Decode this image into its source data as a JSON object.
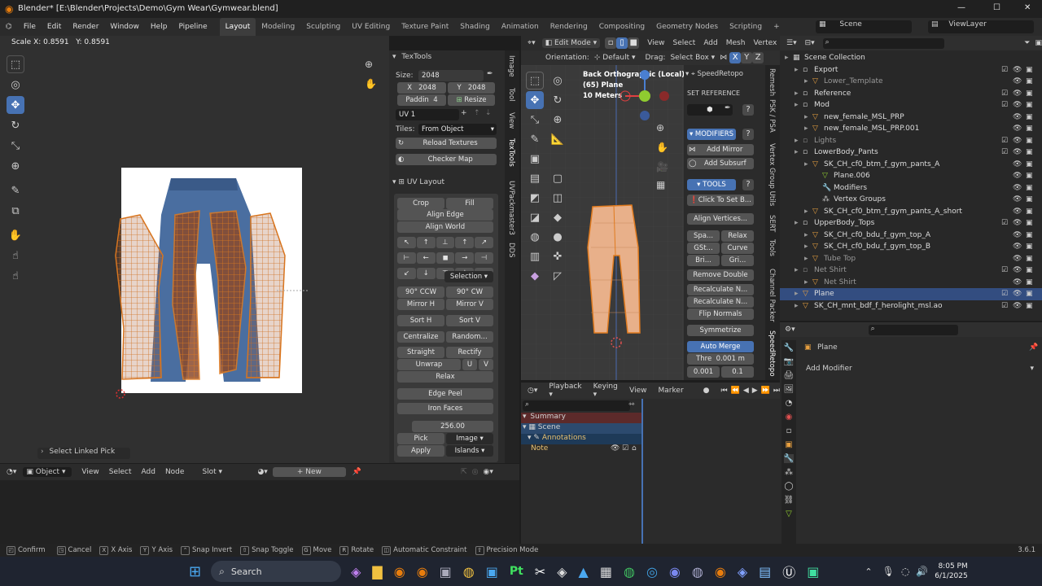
{
  "window": {
    "title": "Blender* [E:\\Blender\\Projects\\Demo\\Gym Wear\\Gymwear.blend]",
    "minimize": "—",
    "maximize": "☐",
    "close": "✕"
  },
  "menu": [
    "File",
    "Edit",
    "Render",
    "Window",
    "Help",
    "Pipeline"
  ],
  "workspaces": [
    "Layout",
    "Modeling",
    "Sculpting",
    "UV Editing",
    "Texture Paint",
    "Shading",
    "Animation",
    "Rendering",
    "Compositing",
    "Geometry Nodes",
    "Scripting"
  ],
  "active_workspace": "Layout",
  "scene_field": "Scene",
  "viewlayer_field": "ViewLayer",
  "uv_editor": {
    "header_text": "Scale X: 0.8591   Y: 0.8591",
    "select_linked_hint": "Select Linked Pick",
    "scale_value": "0.8591"
  },
  "textools": {
    "title": "TexTools",
    "size_label": "Size:",
    "size_value": "2048",
    "x_label": "X",
    "x_value": "2048",
    "y_label": "Y",
    "y_value": "2048",
    "padding_label": "Paddin",
    "padding_value": "4",
    "resize": "Resize",
    "uv_map": "UV 1",
    "tiles_label": "Tiles:",
    "tiles_value": "From Object",
    "reload": "Reload Textures",
    "checker": "Checker Map",
    "uv_layout": "UV Layout",
    "crop": "Crop",
    "fill": "Fill",
    "align_edge": "Align Edge",
    "align_world": "Align World",
    "selection": "Selection",
    "ccw": "90° CCW",
    "cw": "90° CW",
    "mirror_h": "Mirror H",
    "mirror_v": "Mirror V",
    "sort_h": "Sort H",
    "sort_v": "Sort V",
    "centralize": "Centralize",
    "random": "Random...",
    "straight": "Straight",
    "rectify": "Rectify",
    "unwrap": "Unwrap",
    "u": "U",
    "v": "V",
    "relax": "Relax",
    "edge_peel": "Edge Peel",
    "iron_faces": "Iron Faces",
    "texel": "256.00",
    "pick": "Pick",
    "image": "Image",
    "apply": "Apply",
    "islands": "Islands",
    "side_tabs": [
      "Image",
      "Tool",
      "View",
      "TexTools",
      "UVPackmaster3",
      "DDS"
    ]
  },
  "viewport": {
    "mode": "Edit Mode",
    "menus": [
      "View",
      "Select",
      "Add",
      "Mesh",
      "Vertex"
    ],
    "orientation_label": "Orientation:",
    "orientation_value": "Default",
    "drag_label": "Drag:",
    "drag_value": "Select Box",
    "axes": [
      "X",
      "Y",
      "Z"
    ],
    "overlay_line1": "Back Orthographic (Local)",
    "overlay_line2": "(65) Plane",
    "overlay_line3": "10 Meters",
    "side_tabs": [
      "Remesh",
      "PSK / PSA",
      "Vertex Group Utils",
      "SERT",
      "Tools",
      "Channel Packer",
      "SpeedRetopo"
    ]
  },
  "speedretopo": {
    "title": "SpeedRetopo",
    "set_reference": "SET REFERENCE",
    "modifiers": "MODIFIERS",
    "add_mirror": "Add Mirror",
    "add_subsurf": "Add Subsurf",
    "tools": "TOOLS",
    "click_to_set": "Click To Set B...",
    "align_vertices": "Align Vertices...",
    "spa": "Spa...",
    "relax": "Relax",
    "gst": "GSt...",
    "curve": "Curve",
    "bri": "Bri...",
    "gri": "Gri...",
    "remove_double": "Remove Double",
    "recalc1": "Recalculate N...",
    "recalc2": "Recalculate N...",
    "flip_normals": "Flip Normals",
    "symmetrize": "Symmetrize",
    "auto_merge": "Auto Merge",
    "thre_label": "Thre",
    "thre_value": "0.001 m",
    "v1": "0.001",
    "v2": "0.1"
  },
  "timeline": {
    "menus": [
      "Playback",
      "Keying",
      "View",
      "Marker"
    ],
    "rows": [
      {
        "label": "Summary"
      },
      {
        "label": "Scene"
      },
      {
        "label": "Annotations"
      },
      {
        "label": "Note"
      }
    ]
  },
  "outliner": {
    "items": [
      {
        "label": "Scene Collection",
        "depth": 0
      },
      {
        "label": "Export",
        "depth": 1
      },
      {
        "label": "Lower_Template",
        "depth": 2
      },
      {
        "label": "Reference",
        "depth": 1
      },
      {
        "label": "Mod",
        "depth": 1
      },
      {
        "label": "new_female_MSL_PRP",
        "depth": 2
      },
      {
        "label": "new_female_MSL_PRP.001",
        "depth": 2
      },
      {
        "label": "Lights",
        "depth": 1
      },
      {
        "label": "LowerBody_Pants",
        "depth": 1
      },
      {
        "label": "SK_CH_cf0_btm_f_gym_pants_A",
        "depth": 2
      },
      {
        "label": "Plane.006",
        "depth": 3
      },
      {
        "label": "Modifiers",
        "depth": 3
      },
      {
        "label": "Vertex Groups",
        "depth": 3
      },
      {
        "label": "SK_CH_cf0_btm_f_gym_pants_A_short",
        "depth": 2
      },
      {
        "label": "UpperBody_Tops",
        "depth": 1
      },
      {
        "label": "SK_CH_cf0_bdu_f_gym_top_A",
        "depth": 2
      },
      {
        "label": "SK_CH_cf0_bdu_f_gym_top_B",
        "depth": 2
      },
      {
        "label": "Tube Top",
        "depth": 2
      },
      {
        "label": "Net Shirt",
        "depth": 1
      },
      {
        "label": "Net Shirt",
        "depth": 2
      },
      {
        "label": "Plane",
        "depth": 1
      },
      {
        "label": "SK_CH_mnt_bdf_f_herolight_msl.ao",
        "depth": 1
      }
    ]
  },
  "properties": {
    "object_name": "Plane",
    "add_modifier": "Add Modifier"
  },
  "node_editor": {
    "object": "Object",
    "menus": [
      "View",
      "Select",
      "Add",
      "Node"
    ],
    "slot": "Slot",
    "new": "New"
  },
  "statusbar": {
    "items": [
      "Confirm",
      "Cancel",
      "X Axis",
      "Y Axis",
      "Snap Invert",
      "Snap Toggle",
      "Move",
      "Rotate",
      "Automatic Constraint",
      "Precision Mode"
    ],
    "keys": [
      "",
      "",
      "X",
      "Y",
      "",
      "",
      "G",
      "R",
      "",
      ""
    ],
    "version": "3.6.1"
  },
  "taskbar": {
    "search": "Search",
    "time": "8:05 PM",
    "date": "6/1/2025"
  },
  "colors": {
    "accent": "#4772b3",
    "mesh": "#e07a1e",
    "bg": "#303030"
  }
}
